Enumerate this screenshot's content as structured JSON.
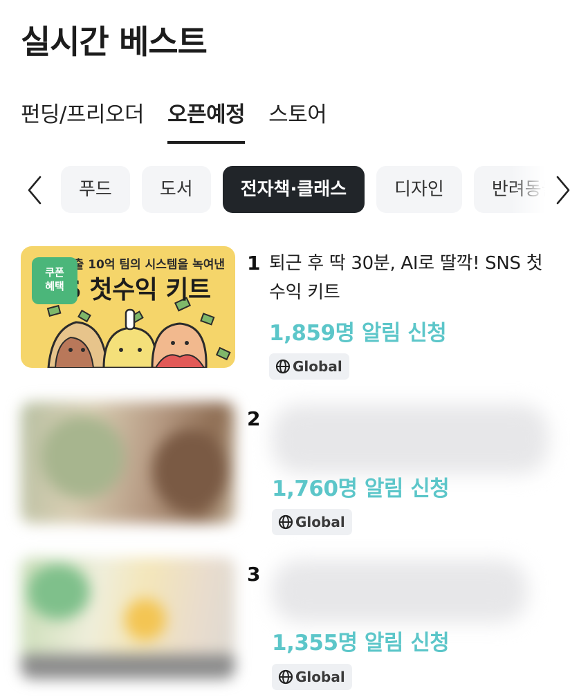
{
  "header": {
    "title": "실시간 베스트"
  },
  "tabs": [
    {
      "label": "펀딩/프리오더",
      "active": false
    },
    {
      "label": "오픈예정",
      "active": true
    },
    {
      "label": "스토어",
      "active": false
    }
  ],
  "categories": {
    "items": [
      "푸드",
      "도서",
      "전자책·클래스",
      "디자인",
      "반려동물"
    ],
    "active_index": 2
  },
  "ranking": [
    {
      "rank": "1",
      "title": "퇴근 후 딱 30분, AI로 딸깍! SNS 첫수익 키트",
      "notify": "1,859명 알림 신청",
      "badge": "Global",
      "thumb": {
        "headline": "매출 10억 팀의 시스템을 녹여낸",
        "big_text": "S 첫수익 키트",
        "coupon": "쿠폰\n혜택"
      }
    },
    {
      "rank": "2",
      "notify": "1,760명 알림 신청",
      "badge": "Global"
    },
    {
      "rank": "3",
      "notify": "1,355명 알림 신청",
      "badge": "Global"
    }
  ],
  "colors": {
    "accent": "#5cc6c9",
    "coupon": "#4bb67a",
    "chip_active": "#212529"
  }
}
